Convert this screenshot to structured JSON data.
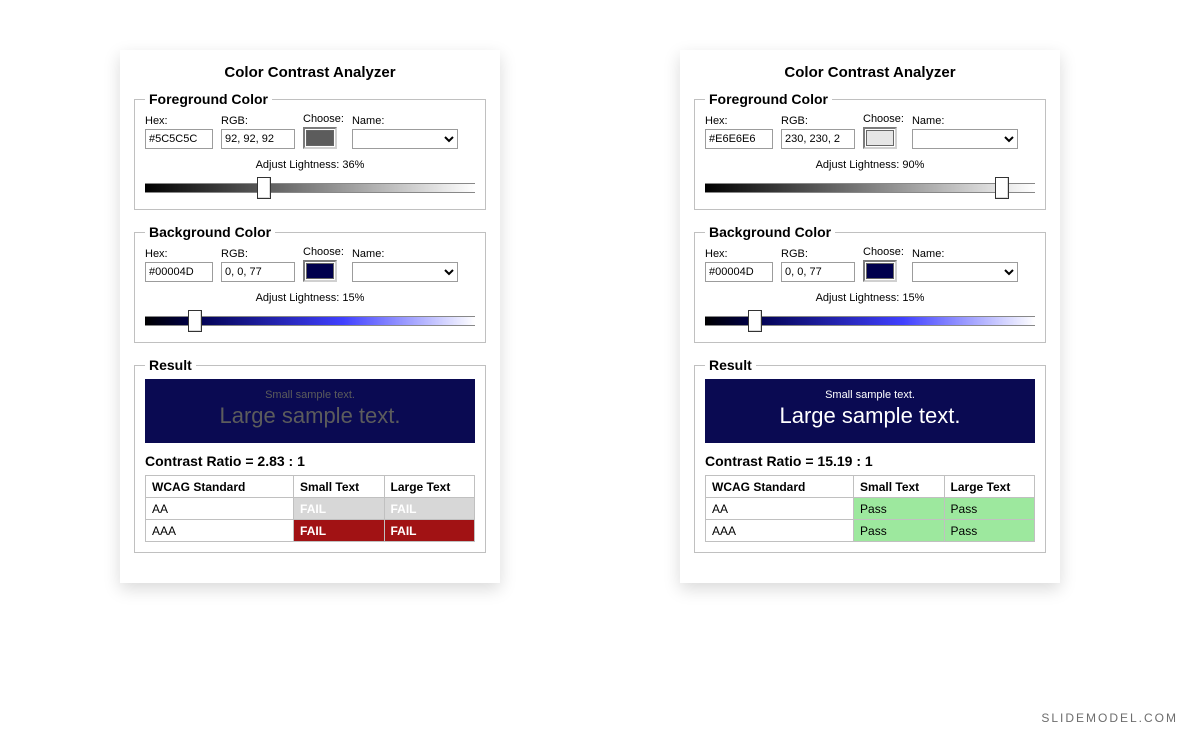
{
  "watermark": "SLIDEMODEL.COM",
  "app_title": "Color Contrast Analyzer",
  "labels": {
    "foreground_legend": "Foreground Color",
    "background_legend": "Background Color",
    "hex": "Hex:",
    "rgb": "RGB:",
    "choose": "Choose:",
    "name": "Name:",
    "adjust_lightness": "Adjust Lightness:",
    "result_legend": "Result",
    "sample_small": "Small sample text.",
    "sample_large": "Large sample text.",
    "contrast_ratio_prefix": "Contrast Ratio = ",
    "th_standard": "WCAG Standard",
    "th_small": "Small Text",
    "th_large": "Large Text",
    "aa": "AA",
    "aaa": "AAA",
    "pass": "Pass",
    "fail": "FAIL"
  },
  "panels": [
    {
      "foreground": {
        "hex": "#5C5C5C",
        "rgb": "92, 92, 92",
        "swatch": "#5c5c5c",
        "lightness_pct": 36,
        "lightness_text": "36%",
        "gradient": "linear-gradient(90deg,#000,#5c5c5c 36%,#ffffff)"
      },
      "background": {
        "hex": "#00004D",
        "rgb": "0, 0, 77",
        "swatch": "#00004d",
        "lightness_pct": 15,
        "lightness_text": "15%",
        "gradient": "linear-gradient(90deg,#000,#00004d 15%,#4040ff 60%,#ffffff)"
      },
      "sample_fg": "#5c5c5c",
      "sample_bg": "#0a0a52",
      "ratio": "2.83 : 1",
      "rows": [
        {
          "std": "AA",
          "small": "FAIL",
          "large": "FAIL",
          "small_cls": "fail-soft",
          "large_cls": "fail-soft"
        },
        {
          "std": "AAA",
          "small": "FAIL",
          "large": "FAIL",
          "small_cls": "fail-hard",
          "large_cls": "fail-hard"
        }
      ]
    },
    {
      "foreground": {
        "hex": "#E6E6E6",
        "rgb": "230, 230, 2",
        "swatch": "#e6e6e6",
        "lightness_pct": 90,
        "lightness_text": "90%",
        "gradient": "linear-gradient(90deg,#000,#e6e6e6 90%,#ffffff)"
      },
      "background": {
        "hex": "#00004D",
        "rgb": "0, 0, 77",
        "swatch": "#00004d",
        "lightness_pct": 15,
        "lightness_text": "15%",
        "gradient": "linear-gradient(90deg,#000,#00004d 15%,#4040ff 60%,#ffffff)"
      },
      "sample_fg": "#ffffff",
      "sample_bg": "#0a0a52",
      "ratio": "15.19 : 1",
      "rows": [
        {
          "std": "AA",
          "small": "Pass",
          "large": "Pass",
          "small_cls": "pass",
          "large_cls": "pass"
        },
        {
          "std": "AAA",
          "small": "Pass",
          "large": "Pass",
          "small_cls": "pass",
          "large_cls": "pass"
        }
      ]
    }
  ]
}
